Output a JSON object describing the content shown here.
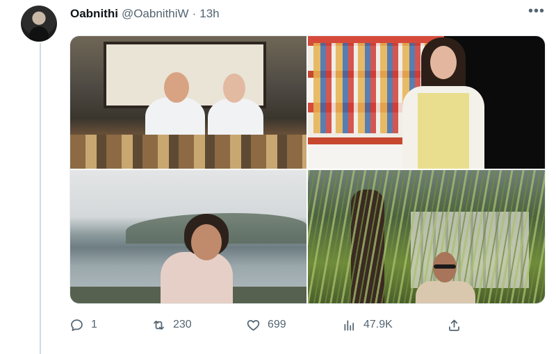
{
  "tweet": {
    "author_name": "Oabnithi",
    "author_handle": "@OabnithiW",
    "separator": "·",
    "time": "13h",
    "more_icon": "more-horizontal-icon",
    "media": [
      {
        "name": "photo-family-restaurant"
      },
      {
        "name": "photo-vending-machine-girl"
      },
      {
        "name": "photo-woman-lake-view"
      },
      {
        "name": "photo-man-under-willow"
      }
    ],
    "actions": {
      "reply_count": "1",
      "retweet_count": "230",
      "like_count": "699",
      "views_count": "47.9K"
    }
  },
  "colors": {
    "text_primary": "#0f1419",
    "text_secondary": "#536471",
    "thread_line": "#cfd9de"
  }
}
